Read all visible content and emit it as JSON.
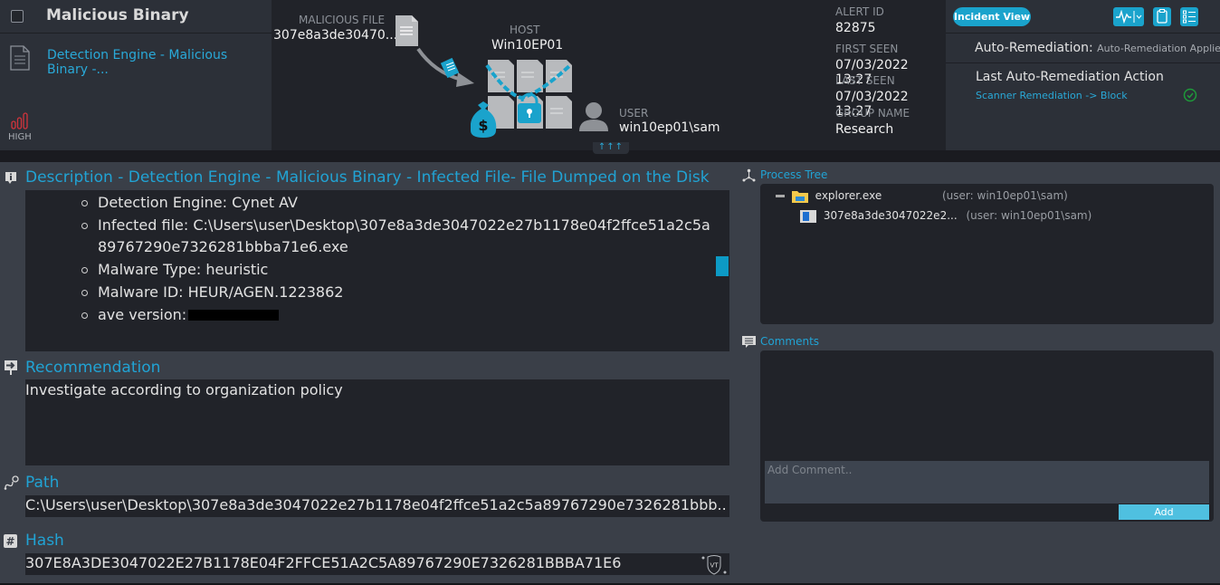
{
  "header": {
    "alert_title": "Malicious Binary",
    "detection_link": "Detection Engine - Malicious Binary -...",
    "severity": "HIGH",
    "malicious_file_label": "MALICIOUS FILE",
    "malicious_file_value": "307e8a3de30470...",
    "host_label": "HOST",
    "host_value": "Win10EP01",
    "user_label": "USER",
    "user_value": "win10ep01\\sam",
    "collapse_glyph": "↑↑↑"
  },
  "meta": {
    "alert_id_label": "ALERT ID",
    "alert_id": "82875",
    "first_seen_label": "FIRST SEEN",
    "first_seen": "07/03/2022 13:27",
    "last_seen_label": "LAST SEEN",
    "last_seen": "07/03/2022 13:27",
    "group_name_label": "GROUP NAME",
    "group_name": "Research"
  },
  "right_panel": {
    "incident_view_label": "Incident View",
    "auto_remediation_label": "Auto-Remediation:",
    "auto_remediation_value": "Auto-Remediation Applied",
    "last_action_label": "Last Auto-Remediation Action",
    "last_action_value": "Scanner Remediation -> Block",
    "status_color": "#1e9a3a"
  },
  "description": {
    "title": "Description - Detection Engine - Malicious Binary - Infected File- File Dumped on the Disk",
    "items": [
      "Detection Engine: Cynet AV",
      "Infected file: C:\\Users\\user\\Desktop\\307e8a3de3047022e27b1178e04f2ffce51a2c5a89767290e7326281bbba71e6.exe",
      "Malware Type: heuristic",
      "Malware ID: HEUR/AGEN.1223862",
      "ave version:"
    ]
  },
  "recommendation": {
    "title": "Recommendation",
    "text": "Investigate according to organization policy"
  },
  "path": {
    "title": "Path",
    "value": "C:\\Users\\user\\Desktop\\307e8a3de3047022e27b1178e04f2ffce51a2c5a89767290e7326281bbb..."
  },
  "hash": {
    "title": "Hash",
    "value": "307E8A3DE3047022E27B1178E04F2FFCE51A2C5A89767290E7326281BBBA71E6",
    "vt_label": "VT"
  },
  "process_tree": {
    "title": "Process Tree",
    "nodes": [
      {
        "name": "explorer.exe",
        "user": "(user: win10ep01\\sam)"
      },
      {
        "name": "307e8a3de3047022e2...",
        "user": "(user: win10ep01\\sam)"
      }
    ]
  },
  "comments": {
    "title": "Comments",
    "placeholder": "Add Comment..",
    "add_label": "Add"
  },
  "colors": {
    "accent": "#21a3d4",
    "severity_high": "#d2343c",
    "button": "#1aa3cc"
  }
}
